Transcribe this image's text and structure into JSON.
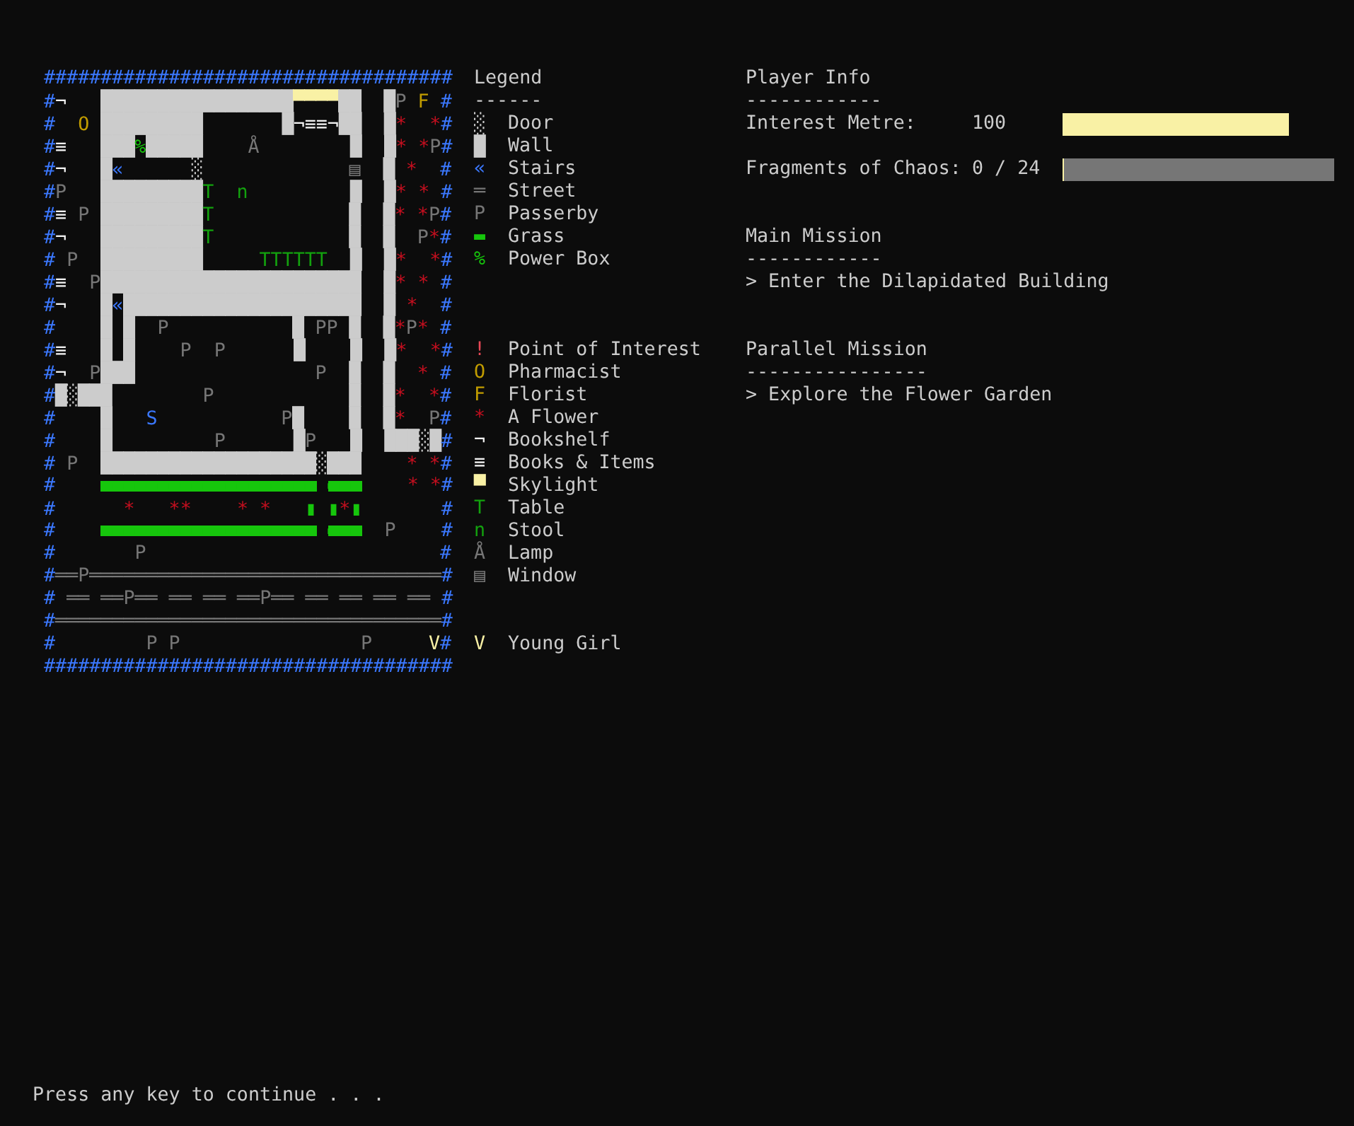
{
  "map": {
    "rows": [
      [
        "####################################"
      ],
      [
        "#¬   █████████████████▀▀▀▀██  █P F #"
      ],
      [
        "#  O █████████       █¬≡≡¬██  █*  *#"
      ],
      [
        "#≡   ███%█████    Å        █  █* *P#"
      ],
      [
        "#¬   █«      ░",
        "             ▤  █ *  #"
      ],
      [
        "#P   █████████T  n         █  █* * #"
      ],
      [
        "#≡ P █████████T",
        "            █  █* *P#"
      ],
      [
        "#¬   █████████T",
        "            █  █  P*#"
      ],
      [
        "# P  █████████     TTTTTT  █  █*  *#"
      ],
      [
        "#≡  P███████████████████████  █* * #"
      ],
      [
        "#¬   █«█████████████████████  █ *  #"
      ],
      [
        "#    █ █  P",
        "           █ PP █  █*P* #"
      ],
      [
        "#≡   █ █    P  P      █    █  █*  *#"
      ],
      [
        "#¬  P███",
        "                P  █  █  * #"
      ],
      [
        "#█░███        P",
        "            █  █*  *#"
      ],
      [
        "#    █   S",
        "           P█    █  █*  P#"
      ],
      [
        "#    █         P      █P   █  ███░█#"
      ],
      [
        "# P  ███████████████████░███    * *#"
      ],
      [
        "#    ▬▬▬▬▬▬▬▬▬▬▬▬▬▬▬▬▬▬▬ ▬▬▬    * *#"
      ],
      [
        "#      *   **    * *   ▮ ▮*▮       #"
      ],
      [
        "#    ▬▬▬▬▬▬▬▬▬▬▬▬▬▬▬▬▬▬▬ ▬▬▬  P    #"
      ],
      [
        "#       P",
        "                          #"
      ],
      [
        "#══P═══════════════════════════════#"
      ],
      [
        "# ══ ══P══ ══ ══ ══P══ ══ ══ ══ ══ #"
      ],
      [
        "#══════════════════════════════════#"
      ],
      [
        "#        P P",
        "                P",
        "     V",
        "#"
      ],
      [
        "####################################"
      ]
    ]
  },
  "legend": {
    "title": "Legend",
    "rule": "------",
    "groups": [
      [
        {
          "symbol": "░",
          "label": "Door"
        },
        {
          "symbol": "█",
          "label": "Wall"
        },
        {
          "symbol": "«",
          "label": "Stairs"
        },
        {
          "symbol": "═",
          "label": "Street"
        },
        {
          "symbol": "P",
          "label": "Passerby"
        },
        {
          "symbol": "▬",
          "label": "Grass"
        },
        {
          "symbol": "%",
          "label": "Power Box"
        }
      ],
      [
        {
          "symbol": "!",
          "label": "Point of Interest"
        },
        {
          "symbol": "O",
          "label": "Pharmacist"
        },
        {
          "symbol": "F",
          "label": "Florist"
        },
        {
          "symbol": "*",
          "label": "A Flower"
        },
        {
          "symbol": "¬",
          "label": "Bookshelf"
        },
        {
          "symbol": "≡",
          "label": "Books & Items"
        },
        {
          "symbol": "▀",
          "label": "Skylight"
        },
        {
          "symbol": "T",
          "label": "Table"
        },
        {
          "symbol": "n",
          "label": "Stool"
        },
        {
          "symbol": "Å",
          "label": "Lamp"
        },
        {
          "symbol": "▤",
          "label": "Window"
        }
      ],
      [
        {
          "symbol": "V",
          "label": "Young Girl"
        }
      ]
    ]
  },
  "player_info": {
    "title": "Player Info",
    "rule": "------------",
    "meters": [
      {
        "label": "Interest Metre:",
        "value": "100",
        "level": 0.833,
        "track": false
      },
      {
        "label": "Fragments of Chaos:",
        "value": "0 / 24",
        "level": 0,
        "track": true
      }
    ]
  },
  "missions": [
    {
      "title": "Main Mission",
      "rule": "------------",
      "objective": "> Enter the Dilapidated Building"
    },
    {
      "title": "Parallel Mission",
      "rule": "----------------",
      "objective": "> Explore the Flower Garden"
    }
  ],
  "prompt": "Press any key to continue . . ."
}
